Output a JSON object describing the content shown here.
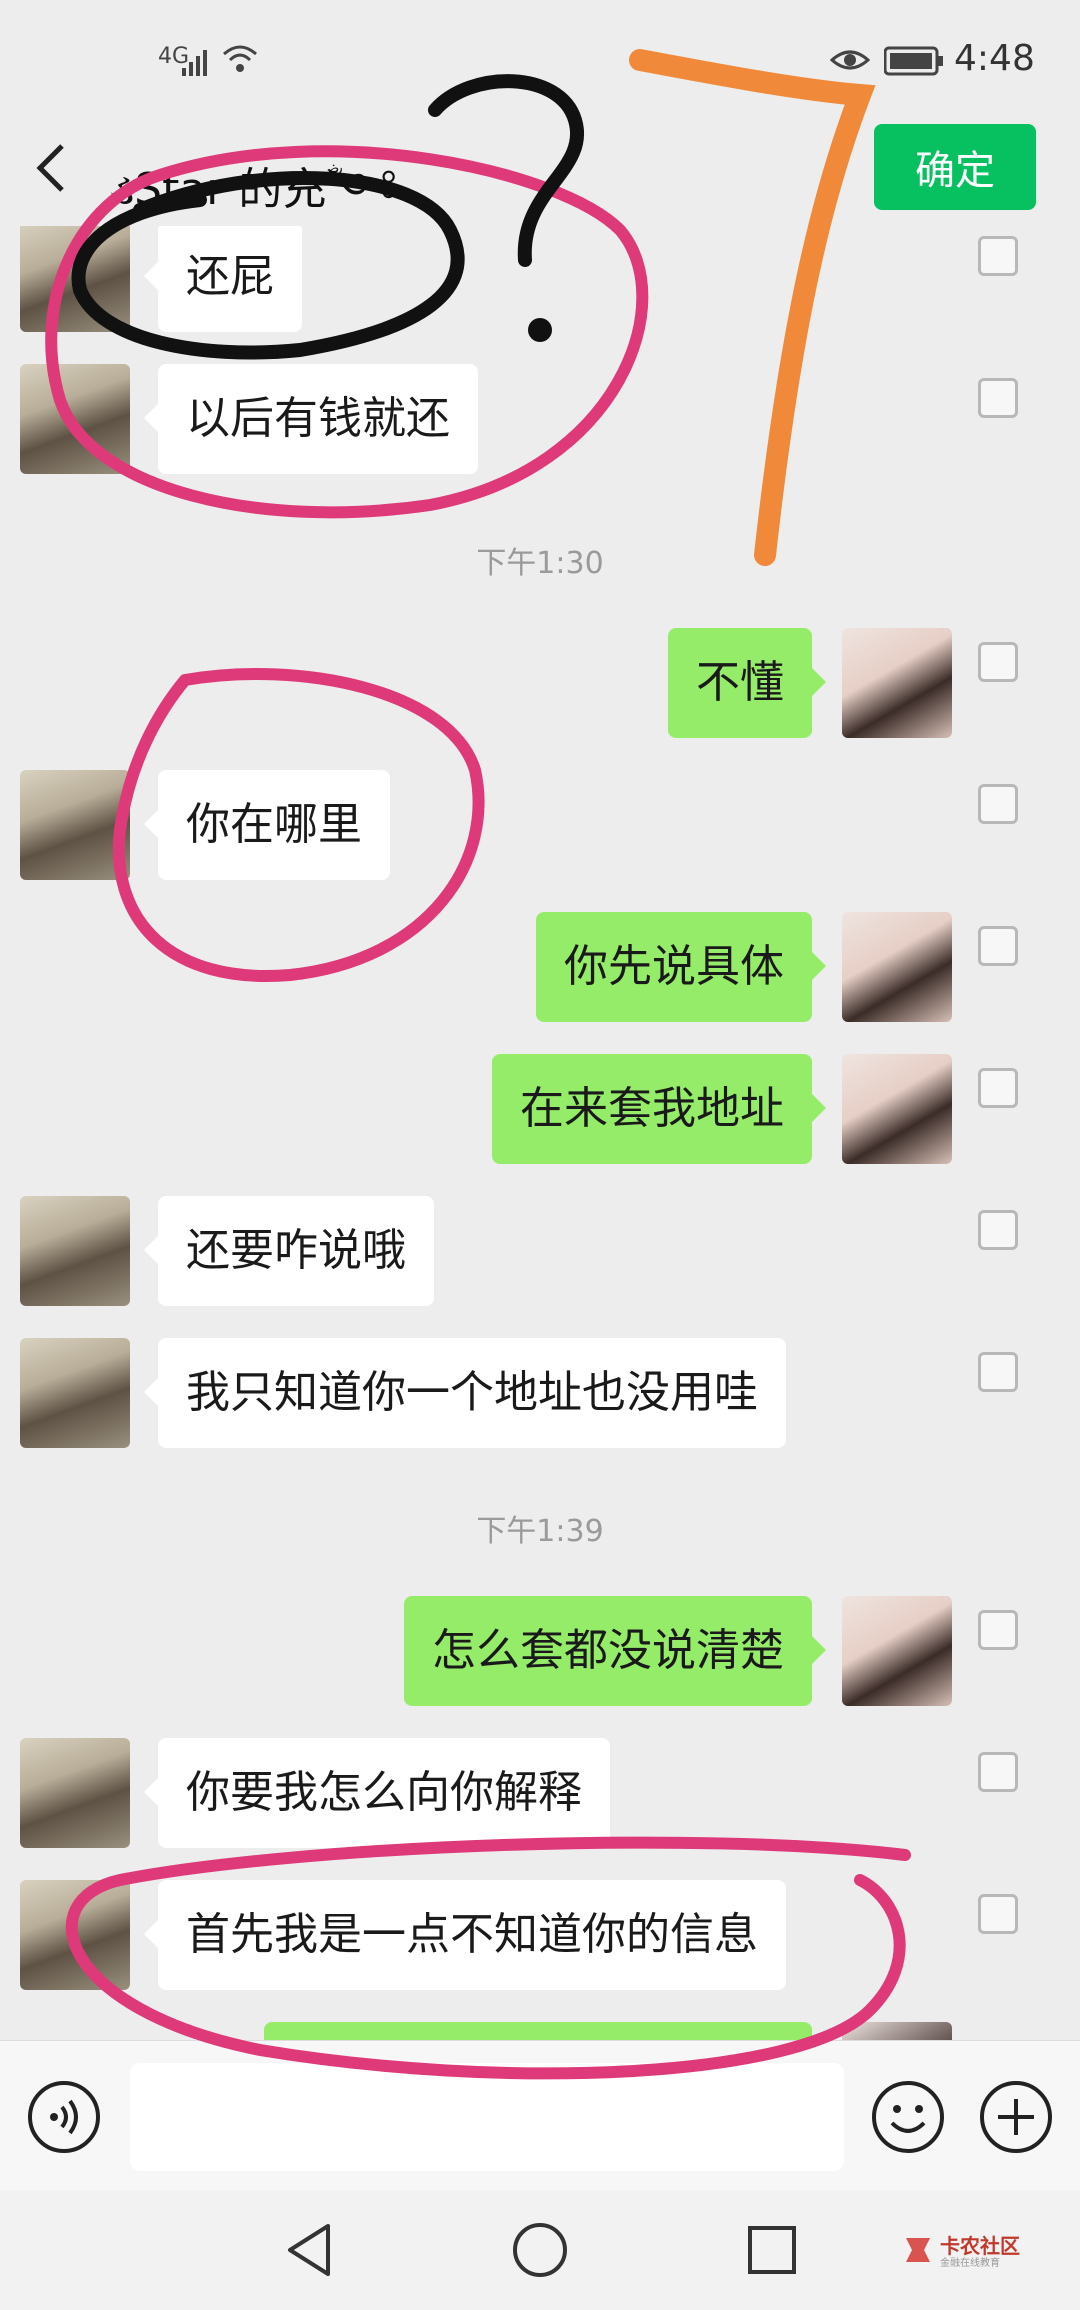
{
  "status_bar": {
    "network": "4G",
    "time": "4:48"
  },
  "header": {
    "title": "ડStar 的充ؓ༺",
    "confirm_label": "确定"
  },
  "messages": [
    {
      "side": "left",
      "text": "还屁"
    },
    {
      "side": "left",
      "text": "以后有钱就还"
    },
    {
      "type": "time",
      "text": "下午1:30"
    },
    {
      "side": "right",
      "text": "不懂"
    },
    {
      "side": "left",
      "text": "你在哪里"
    },
    {
      "side": "right",
      "text": "你先说具体"
    },
    {
      "side": "right",
      "text": "在来套我地址"
    },
    {
      "side": "left",
      "text": "还要咋说哦"
    },
    {
      "side": "left",
      "text": "我只知道你一个地址也没用哇"
    },
    {
      "type": "time",
      "text": "下午1:39"
    },
    {
      "side": "right",
      "text": "怎么套都没说清楚"
    },
    {
      "side": "left",
      "text": "你要我怎么向你解释"
    },
    {
      "side": "left",
      "text": "首先我是一点不知道你的信息"
    }
  ],
  "input": {
    "placeholder": ""
  },
  "watermark": {
    "name": "卡农社区",
    "tagline": "金融在线教育"
  },
  "annotations": {
    "drawn_text": "?",
    "drawn_number": "7"
  }
}
